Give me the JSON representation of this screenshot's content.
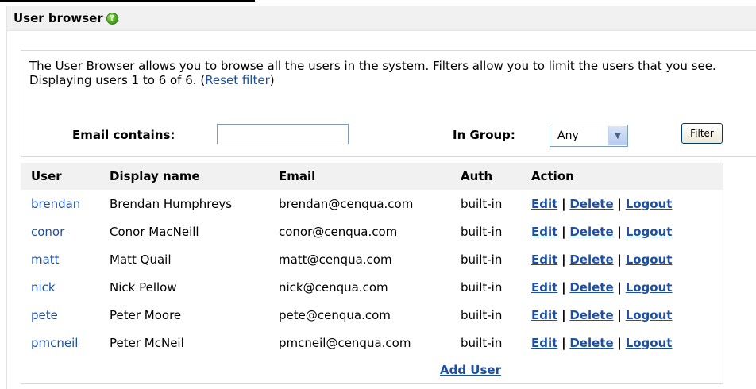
{
  "header": {
    "title": "User browser",
    "help_glyph": "?"
  },
  "info": {
    "description": "The User Browser allows you to browse all the users in the system. Filters allow you to limit the users that you see.",
    "displaying": "Displaying users 1 to 6 of 6.",
    "reset_open": "(",
    "reset_filter": "Reset filter",
    "reset_close": ")"
  },
  "filter": {
    "email_label": "Email contains:",
    "email_value": "",
    "group_label": "In Group:",
    "group_value": "Any",
    "button_label": "Filter"
  },
  "table": {
    "headers": [
      "User",
      "Display name",
      "Email",
      "Auth",
      "Action"
    ],
    "rows": [
      {
        "user": "brendan",
        "display": "Brendan Humphreys",
        "email": "brendan@cenqua.com",
        "auth": "built-in"
      },
      {
        "user": "conor",
        "display": "Conor MacNeill",
        "email": "conor@cenqua.com",
        "auth": "built-in"
      },
      {
        "user": "matt",
        "display": "Matt Quail",
        "email": "matt@cenqua.com",
        "auth": "built-in"
      },
      {
        "user": "nick",
        "display": "Nick Pellow",
        "email": "nick@cenqua.com",
        "auth": "built-in"
      },
      {
        "user": "pete",
        "display": "Peter Moore",
        "email": "pete@cenqua.com",
        "auth": "built-in"
      },
      {
        "user": "pmcneil",
        "display": "Peter McNeil",
        "email": "pmcneil@cenqua.com",
        "auth": "built-in"
      }
    ],
    "actions": {
      "edit": "Edit",
      "delete": "Delete",
      "logout": "Logout",
      "separator": "|"
    },
    "add_user": "Add User"
  },
  "colors": {
    "link": "#1d4fa3",
    "header_bg": "#f1f1f1"
  }
}
